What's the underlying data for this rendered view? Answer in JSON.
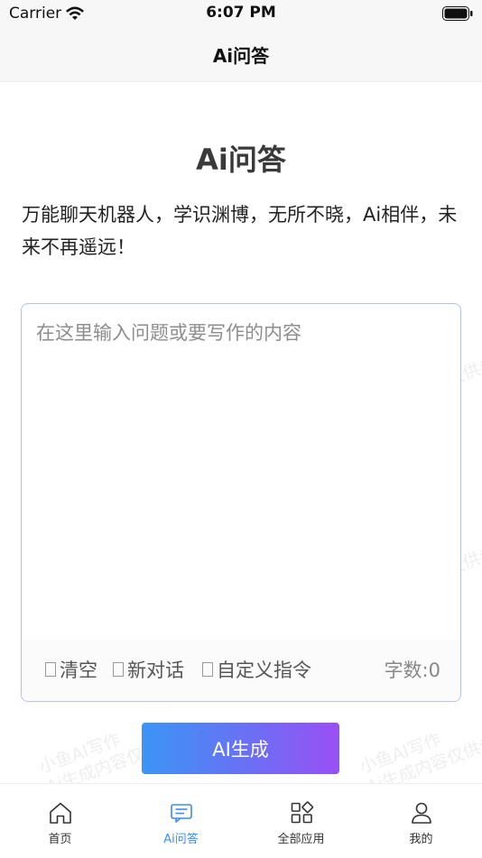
{
  "status_bar": {
    "carrier": "Carrier",
    "time": "6:07 PM"
  },
  "nav": {
    "title": "Ai问答"
  },
  "main": {
    "title": "Ai问答",
    "description": "万能聊天机器人，学识渊博，无所不晓，Ai相伴，未来不再遥远！"
  },
  "editor": {
    "value": "",
    "placeholder": "在这里输入问题或要写作的内容",
    "tools": {
      "clear": "清空",
      "new_chat": "新对话",
      "custom": "自定义指令"
    },
    "word_count": "字数:0"
  },
  "generate_button": "AI生成",
  "watermark": {
    "line1": "小鱼AI写作",
    "line2": "Ai生成内容仅供参考"
  },
  "tabs": [
    {
      "label": "首页",
      "icon": "home-icon"
    },
    {
      "label": "Ai问答",
      "icon": "chat-icon",
      "active": true
    },
    {
      "label": "全部应用",
      "icon": "apps-icon"
    },
    {
      "label": "我的",
      "icon": "user-icon"
    }
  ],
  "colors": {
    "accent": "#3b8ef0",
    "gradient_start": "#3b95f5",
    "gradient_end": "#9b4ff5",
    "border": "#b3c3e6"
  }
}
